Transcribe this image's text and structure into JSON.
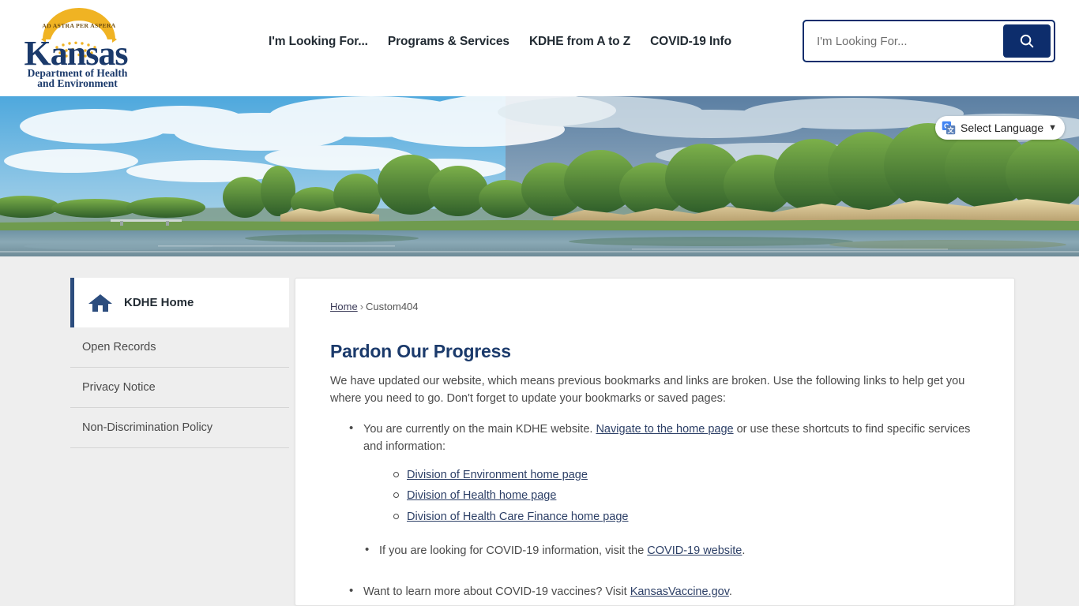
{
  "header": {
    "logo": {
      "motto": "AD ASTRA PER ASPERA",
      "state": "Kansas",
      "dept_line1": "Department of Health",
      "dept_line2": "and Environment"
    },
    "nav": [
      {
        "label": "I'm Looking For...",
        "name": "nav-im-looking-for"
      },
      {
        "label": "Programs & Services",
        "name": "nav-programs-services"
      },
      {
        "label": "KDHE from A to Z",
        "name": "nav-kdhe-a-to-z"
      },
      {
        "label": "COVID-19 Info",
        "name": "nav-covid-19-info"
      }
    ],
    "search": {
      "placeholder": "I'm Looking For...",
      "value": "",
      "button_icon": "search-icon"
    }
  },
  "banner": {
    "language_selector": {
      "label": "Select Language",
      "icon": "google-translate-icon",
      "chevron": "chevron-down-icon"
    }
  },
  "sidebar": {
    "items": [
      {
        "label": "KDHE Home",
        "icon": "home-icon",
        "active": true
      },
      {
        "label": "Open Records",
        "active": false
      },
      {
        "label": "Privacy Notice",
        "active": false
      },
      {
        "label": "Non-Discrimination Policy",
        "active": false
      }
    ]
  },
  "main": {
    "breadcrumb": {
      "home": "Home",
      "separator": "›",
      "current": "Custom404"
    },
    "title": "Pardon Our Progress",
    "intro": "We have updated our website, which means previous bookmarks and links are broken. Use the following links to help get you where you need to go. Don't forget to update your bookmarks or saved pages:",
    "bullet1": {
      "text_before": "You are currently on the main KDHE website. ",
      "link": "Navigate to the home page",
      "text_after": " or use these shortcuts to find specific services and information:"
    },
    "sub_links": [
      "Division of Environment home page",
      "Division of Health home page",
      "Division of Health Care Finance home page"
    ],
    "bullet2": {
      "text_before": "If you are looking for COVID-19 information, visit the ",
      "link": "COVID-19 website",
      "text_after": "."
    },
    "bullet3": {
      "text_before": "Want to learn more about COVID-19 vaccines? Visit ",
      "link": "KansasVaccine.gov",
      "text_after": "."
    }
  },
  "colors": {
    "navy": "#0d2d6c",
    "heading_navy": "#1b3a6b",
    "gold": "#f0b323",
    "accent_bar": "#2c4d7e",
    "page_bg": "#eeeeee"
  }
}
